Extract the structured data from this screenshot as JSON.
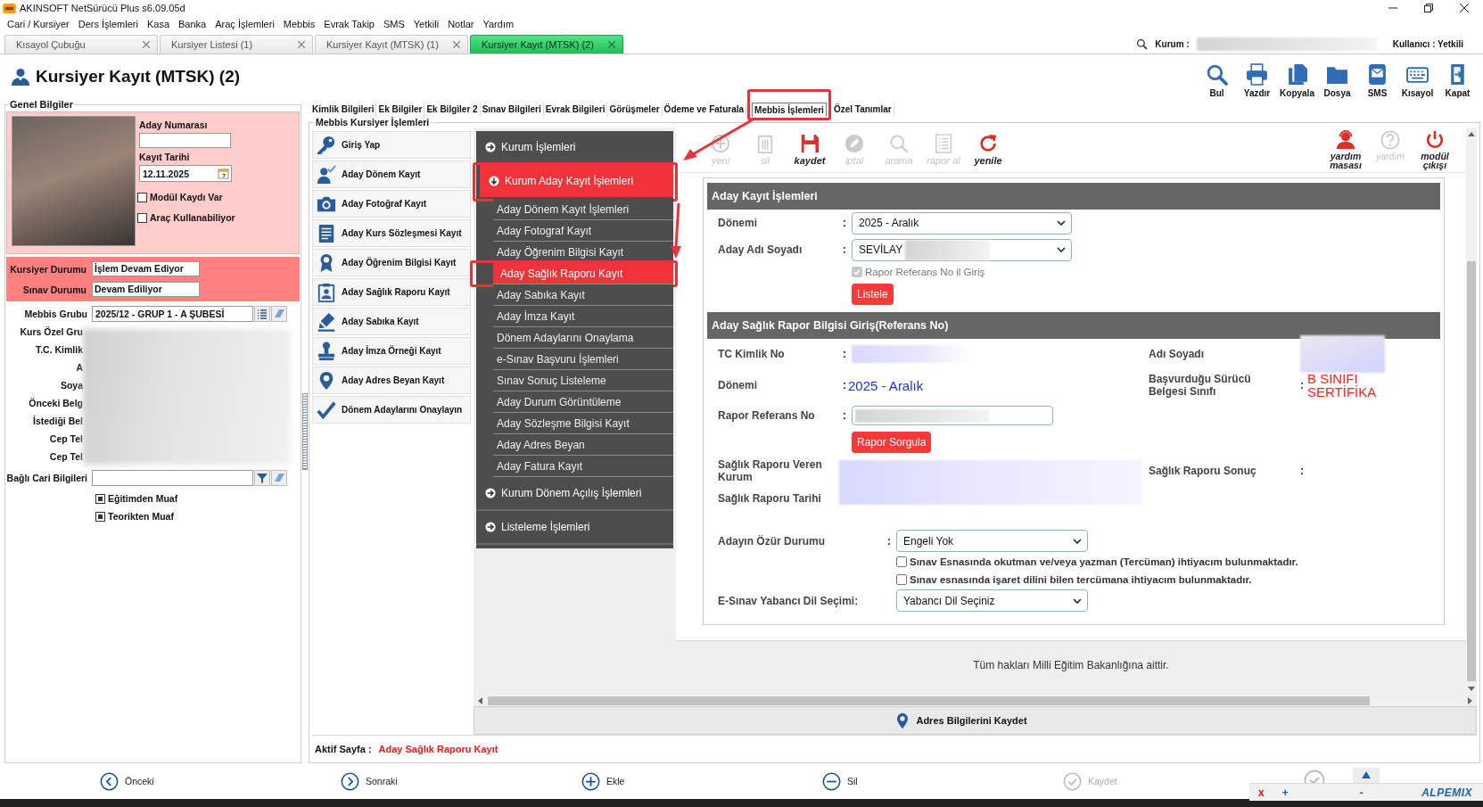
{
  "window": {
    "title": "AKINSOFT NetSürücü Plus s6.09.05d"
  },
  "menu_bar": [
    "Cari / Kursiyer",
    "Ders İşlemleri",
    "Kasa",
    "Banka",
    "Araç İşlemleri",
    "Mebbis",
    "Evrak Takip",
    "SMS",
    "Yetkili",
    "Notlar",
    "Yardım"
  ],
  "document_tabs": [
    {
      "label": "Kısayol Çubuğu",
      "selected": false
    },
    {
      "label": "Kursiyer Listesi (1)",
      "selected": false
    },
    {
      "label": "Kursiyer Kayıt (MTSK) (1)",
      "selected": false
    },
    {
      "label": "Kursiyer Kayıt (MTSK) (2)",
      "selected": true
    }
  ],
  "session": {
    "institution_label": "Kurum :",
    "user": "Kullanıcı : Yetkili"
  },
  "page_title": "Kursiyer Kayıt (MTSK) (2)",
  "toolbar": [
    "Bul",
    "Yazdır",
    "Kopyala",
    "Dosya",
    "SMS",
    "Kısayol",
    "Kapat"
  ],
  "general_info": {
    "title": "Genel Bilgiler",
    "candidate_number": {
      "label": "Aday Numarası"
    },
    "registration_date": {
      "label": "Kayıt Tarihi",
      "value": "12.11.2025"
    },
    "flags": [
      {
        "label": "Modül Kaydı Var",
        "checked": false
      },
      {
        "label": "Araç Kullanabiliyor",
        "checked": false
      }
    ],
    "statuses": [
      {
        "label": "Kursiyer Durumu",
        "value": "İşlem Devam Ediyor"
      },
      {
        "label": "Sınav Durumu",
        "value": "Devam Ediliyor"
      }
    ],
    "mebbis_group": {
      "label": "Mebbis Grubu",
      "value": "2025/12 - GRUP 1 - A ŞUBESİ"
    },
    "obscured_fields": [
      "Kurs Özel Gru",
      "T.C. Kimlik",
      "A",
      "Soya",
      "Önceki Belg",
      "İstediği Bel",
      "Cep Tel",
      "Cep Tel"
    ],
    "linked_account": {
      "label": "Bağlı Cari Bilgileri"
    },
    "exemptions": [
      {
        "label": "Eğitimden Muaf",
        "checked": true
      },
      {
        "label": "Teorikten Muaf",
        "checked": true
      }
    ]
  },
  "record_tabs": [
    {
      "label": "Kimlik Bilgileri",
      "selected": false,
      "highlighted": false
    },
    {
      "label": "Ek Bilgiler",
      "selected": false,
      "highlighted": false
    },
    {
      "label": "Ek Bilgiler 2",
      "selected": false,
      "highlighted": false
    },
    {
      "label": "Sınav Bilgileri",
      "selected": false,
      "highlighted": false
    },
    {
      "label": "Evrak Bilgileri",
      "selected": false,
      "highlighted": false
    },
    {
      "label": "Görüşmeler",
      "selected": false,
      "highlighted": false
    },
    {
      "label": "Ödeme ve Faturala",
      "selected": false,
      "highlighted": false
    },
    {
      "label": "Mebbis İşlemleri",
      "selected": true,
      "highlighted": true
    },
    {
      "label": "Özel Tanımlar",
      "selected": false,
      "highlighted": false
    }
  ],
  "mebbis": {
    "title": "Mebbis Kursiyer İşlemleri",
    "actions": [
      "Giriş Yap",
      "Aday Dönem Kayıt",
      "Aday Fotoğraf Kayıt",
      "Aday Kurs Sözleşmesi Kayıt",
      "Aday Öğrenim Bilgisi Kayıt",
      "Aday Sağlık Raporu Kayıt",
      "Aday Sabıka Kayıt",
      "Aday İmza Örneği Kayıt",
      "Aday Adres Beyan Kayıt",
      "Dönem Adaylarını Onaylayın"
    ]
  },
  "web_menu": [
    {
      "label": "Kurum İşlemleri",
      "expanded": false,
      "selected": false,
      "highlighted": false
    },
    {
      "label": "Kurum Aday Kayıt İşlemleri",
      "expanded": true,
      "selected": true,
      "highlighted": true,
      "children": [
        {
          "label": "Aday Dönem Kayıt İşlemleri",
          "selected": false,
          "highlighted": false
        },
        {
          "label": "Aday Fotograf Kayıt",
          "selected": false,
          "highlighted": false
        },
        {
          "label": "Aday Öğrenim Bilgisi Kayıt",
          "selected": false,
          "highlighted": false
        },
        {
          "label": "Aday Sağlık Raporu Kayıt",
          "selected": true,
          "highlighted": true
        },
        {
          "label": "Aday Sabıka Kayıt",
          "selected": false,
          "highlighted": false
        },
        {
          "label": "Aday İmza Kayıt",
          "selected": false,
          "highlighted": false
        },
        {
          "label": "Dönem Adaylarını Onaylama",
          "selected": false,
          "highlighted": false
        },
        {
          "label": "e-Sınav Başvuru İşlemleri",
          "selected": false,
          "highlighted": false
        },
        {
          "label": "Sınav Sonuç Listeleme",
          "selected": false,
          "highlighted": false
        },
        {
          "label": "Aday Durum Görüntüleme",
          "selected": false,
          "highlighted": false
        },
        {
          "label": "Aday Sözleşme Bilgisi Kayıt",
          "selected": false,
          "highlighted": false
        },
        {
          "label": "Aday Adres Beyan",
          "selected": false,
          "highlighted": false
        },
        {
          "label": "Aday Fatura Kayıt",
          "selected": false,
          "highlighted": false
        }
      ]
    },
    {
      "label": "Kurum Dönem Açılış İşlemleri",
      "expanded": false,
      "selected": false,
      "highlighted": false
    },
    {
      "label": "Listeleme İşlemleri",
      "expanded": false,
      "selected": false,
      "highlighted": false
    }
  ],
  "web_toolbar": [
    {
      "label": "yeni",
      "disabled": true
    },
    {
      "label": "sil",
      "disabled": true
    },
    {
      "label": "kaydet",
      "disabled": false
    },
    {
      "label": "iptal",
      "disabled": true
    },
    {
      "label": "arama",
      "disabled": true
    },
    {
      "label": "rapor al",
      "disabled": true
    },
    {
      "label": "yenile",
      "disabled": false
    }
  ],
  "web_toolbar_right": [
    {
      "label": "yardım masası",
      "disabled": false
    },
    {
      "label": "yardım",
      "disabled": true
    },
    {
      "label": "modül çıkışı",
      "disabled": false
    }
  ],
  "registration_section": {
    "title": "Aday Kayıt İşlemleri",
    "fields": [
      {
        "label": "Dönemi",
        "separator": ":",
        "value": "2025 - Aralık"
      },
      {
        "label": "Aday Adı Soyadı",
        "separator": ":",
        "value": "SEVİLAY"
      }
    ],
    "reference_option": {
      "label": "Rapor Referans No il Giriş",
      "checked": true,
      "disabled": true
    },
    "list_button": "Listele"
  },
  "health_section": {
    "title": "Aday Sağlık Rapor Bilgisi Giriş(Referans No)",
    "tc_no": {
      "label": "TC Kimlik No",
      "separator": ":"
    },
    "name": {
      "label": "Adı Soyadı"
    },
    "period": {
      "label": "Dönemi",
      "separator": ":",
      "value": "2025 - Aralık"
    },
    "license_class": {
      "label": "Başvurduğu Sürücü Belgesi Sınıfı",
      "separator": ":",
      "value": "B SINIFI SERTİFİKA"
    },
    "reference_no": {
      "label": "Rapor Referans No",
      "separator": ":"
    },
    "query_button": "Rapor Sorgula",
    "issuer": {
      "label": "Sağlık Raporu Veren Kurum"
    },
    "result": {
      "label": "Sağlık Raporu Sonuç",
      "separator": ":"
    },
    "report_date": {
      "label": "Sağlık Raporu Tarihi"
    },
    "disability": {
      "label": "Adayın Özür Durumu",
      "separator": ":",
      "value": "Engeli Yok"
    },
    "needs": [
      {
        "label": "Sınav Esnasında okutman ve/veya yazman (Tercüman) ihtiyacım bulunmaktadır.",
        "checked": false
      },
      {
        "label": "Sınav esnasında işaret dilini bilen tercümana ihtiyacım bulunmaktadır.",
        "checked": false
      }
    ],
    "language": {
      "label": "E-Sınav Yabancı Dil Seçimi:",
      "value": "Yabancı Dil Seçiniz"
    }
  },
  "web_footer": "Tüm hakları Milli Eğitim Bakanlığına aittir.",
  "save_bar": "Adres Bilgilerini Kaydet",
  "active_page": {
    "label": "Aktif Sayfa :",
    "value": "Aday Sağlık Raporu Kayıt"
  },
  "nav_buttons": [
    {
      "label": "Önceki",
      "disabled": false
    },
    {
      "label": "Sonraki",
      "disabled": false
    },
    {
      "label": "Ekle",
      "disabled": false
    },
    {
      "label": "Sil",
      "disabled": false
    },
    {
      "label": "Kaydet",
      "disabled": true
    }
  ],
  "remote_widget": {
    "close": "x",
    "add": "+",
    "minimize": "-",
    "logo": "ALPEMIX"
  }
}
